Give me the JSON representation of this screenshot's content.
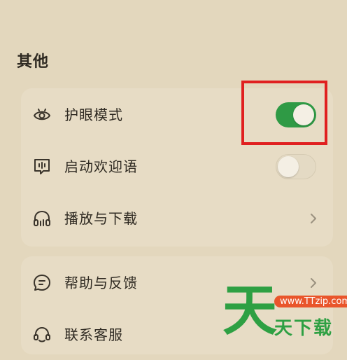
{
  "section": {
    "title": "其他"
  },
  "settings": [
    {
      "label": "护眼模式",
      "icon": "eye-icon",
      "control": "toggle",
      "checked": true
    },
    {
      "label": "启动欢迎语",
      "icon": "chat-bubble-icon",
      "control": "toggle",
      "checked": false
    },
    {
      "label": "播放与下载",
      "icon": "headphones-icon",
      "control": "chevron"
    }
  ],
  "support": [
    {
      "label": "帮助与反馈",
      "icon": "feedback-icon",
      "control": "chevron"
    },
    {
      "label": "联系客服",
      "icon": "customer-service-icon",
      "control": "none"
    }
  ],
  "watermark": {
    "big": "天",
    "pill": "www.TTzip.com",
    "small": "天下载"
  },
  "colors": {
    "toggle_on": "#2f9a45",
    "highlight": "#e02020",
    "background": "#e3d7bd"
  }
}
